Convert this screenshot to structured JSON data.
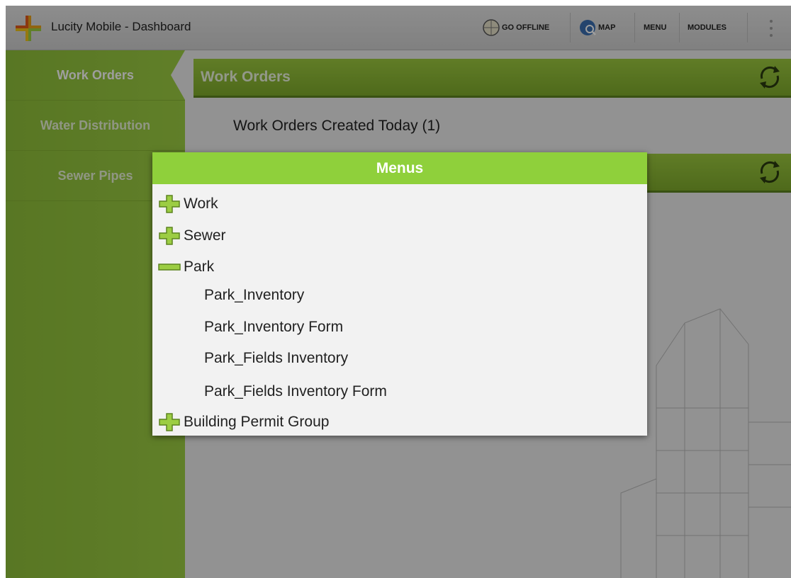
{
  "app": {
    "title": "Lucity Mobile - Dashboard"
  },
  "toolbar": {
    "go_offline": "GO OFFLINE",
    "map": "MAP",
    "menu": "MENU",
    "modules": "MODULES"
  },
  "sidebar": {
    "items": [
      {
        "label": "Work Orders",
        "active": true
      },
      {
        "label": "Water Distribution",
        "active": false
      },
      {
        "label": "Sewer Pipes",
        "active": false
      }
    ]
  },
  "main": {
    "sections": [
      {
        "title": "Work Orders",
        "links": [
          "Work Orders Created Today (1)"
        ]
      },
      {
        "title": ""
      }
    ]
  },
  "dialog": {
    "title": "Menus",
    "groups": [
      {
        "label": "Work",
        "expanded": false,
        "icon": "plus-icon"
      },
      {
        "label": "Sewer",
        "expanded": false,
        "icon": "plus-icon"
      },
      {
        "label": "Park",
        "expanded": true,
        "icon": "minus-icon",
        "items": [
          "Park_Inventory",
          "Park_Inventory Form",
          "Park_Fields Inventory",
          "Park_Fields Inventory Form"
        ]
      },
      {
        "label": "Building Permit Group",
        "expanded": false,
        "icon": "plus-icon"
      }
    ]
  },
  "colors": {
    "accent": "#8fd03b",
    "sidebar": "#9ccd43",
    "header": "#7fab2c"
  }
}
